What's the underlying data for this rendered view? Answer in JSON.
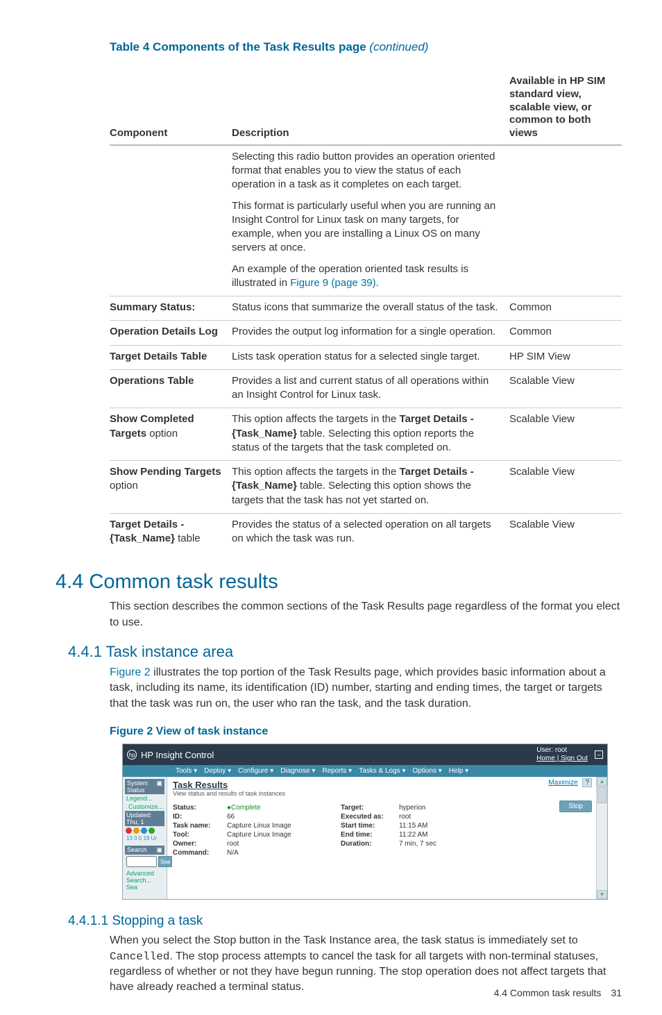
{
  "table_title": {
    "prefix": "Table 4 Components of the Task Results page",
    "suffix": "(continued)"
  },
  "columns": {
    "c1": "Component",
    "c2": "Description",
    "c3": "Available in HP SIM standard view, scalable view, or common to both views"
  },
  "rows": [
    {
      "component_html": "",
      "description_html": "<div class='para'>Selecting this radio button provides an operation oriented format that enables you to view the status of each operation in a task as it completes on each target.</div><div class='para'>This format is particularly useful when you are running an Insight Control for Linux task on many targets, for example, when you are installing a Linux OS on many servers at once.</div><div class='para'>An example of the operation oriented task results is illustrated in <span class='link'>Figure 9 (page 39)</span>.</div>",
      "view": "",
      "no_top_border": true
    },
    {
      "component_html": "Summary Status:",
      "description_html": "Status icons that summarize the overall status of the task.",
      "view": "Common"
    },
    {
      "component_html": "Operation Details Log",
      "description_html": "Provides the output log information for a single operation.",
      "view": "Common"
    },
    {
      "component_html": "Target Details Table",
      "description_html": "Lists task operation status for a selected single target.",
      "view": "HP SIM View"
    },
    {
      "component_html": "Operations Table",
      "description_html": "Provides a list and current status of all operations within an Insight Control for Linux task.",
      "view": "Scalable View"
    },
    {
      "component_html": "<span>Show Completed Targets</span> <span class='light'>option</span>",
      "description_html": "This option affects the targets in the <strong>Target Details - {Task_Name}</strong> table. Selecting this option reports the status of the targets that the task completed on.",
      "view": "Scalable View"
    },
    {
      "component_html": "<span>Show Pending Targets</span> <span class='light'>option</span>",
      "description_html": "This option affects the targets in the <strong>Target Details - {Task_Name}</strong> table. Selecting this option shows the targets that the task has not yet started on.",
      "view": "Scalable View"
    },
    {
      "component_html": "<span>Target Details - {Task_Name}</span> <span class='light'>table</span>",
      "description_html": "Provides the status of a selected operation on all targets on which the task was run.",
      "view": "Scalable View"
    }
  ],
  "sec44": {
    "title": "4.4 Common task results",
    "body": "This section describes the common sections of the Task Results page regardless of the format you elect to use."
  },
  "sec441": {
    "title": "4.4.1 Task instance area",
    "body_html": "<span class='link'>Figure 2</span> illustrates the top portion of the Task Results page, which provides basic information about a task, including its name, its identification (ID) number, starting and ending times, the target or targets that the task was run on, the user who ran the task, and the task duration."
  },
  "figure": {
    "title": "Figure 2 View of task instance",
    "brand": "HP Insight Control",
    "user_label": "User: root",
    "user_links": "Home | Sign Out",
    "menus": [
      "Tools",
      "Deploy",
      "Configure",
      "Diagnose",
      "Reports",
      "Tasks & Logs",
      "Options",
      "Help"
    ],
    "sidebar": {
      "system_status": "System Status",
      "legend": "Legend...",
      "customize": "Customize...",
      "updated": "Updated: Thu, 1",
      "counts": "13  0  0  19 Ur",
      "search": "Search",
      "advanced": "Advanced Search...  Sea"
    },
    "main": {
      "heading": "Task Results",
      "subheading": "View status and results of task instances",
      "maximize": "Maximize",
      "stop": "Stop",
      "kv_left": [
        [
          "Status:",
          "Complete",
          true
        ],
        [
          "ID:",
          "66"
        ],
        [
          "Task name:",
          "Capture Linux Image"
        ],
        [
          "Tool:",
          "Capture Linux Image"
        ],
        [
          "Owner:",
          "root"
        ],
        [
          "Command:",
          "N/A"
        ]
      ],
      "kv_right": [
        [
          "Target:",
          "hyperion"
        ],
        [
          "Executed as:",
          "root"
        ],
        [
          "Start time:",
          "11:15 AM"
        ],
        [
          "End time:",
          "11:22 AM"
        ],
        [
          "Duration:",
          "7 min, 7 sec"
        ]
      ]
    }
  },
  "sec4411": {
    "title": "4.4.1.1 Stopping a task",
    "body_html": "When you select the <strong>Stop</strong> button in the Task Instance area, the task status is immediately set to <span class='mono'>Cancelled</span>. The stop process attempts to cancel the task for all targets with non-terminal statuses, regardless of whether or not they have begun running. The stop operation does not affect targets that have already reached a terminal status."
  },
  "footer": {
    "section": "4.4 Common task results",
    "page": "31"
  }
}
